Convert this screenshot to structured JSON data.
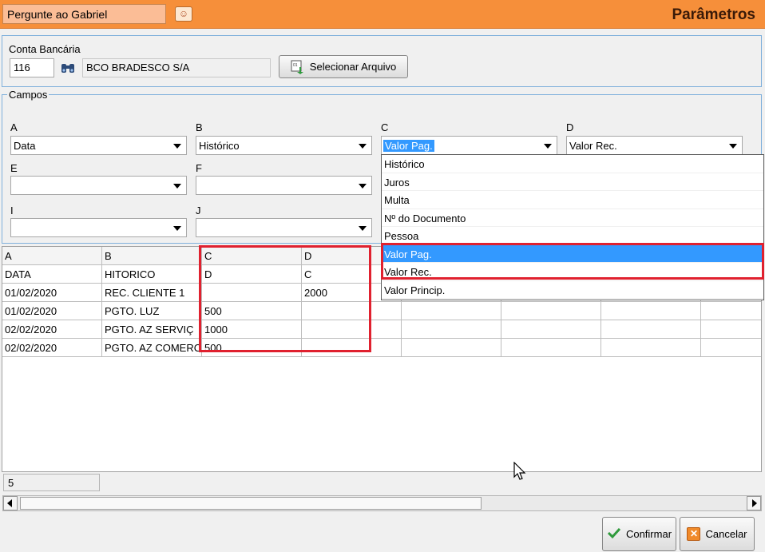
{
  "header": {
    "ask_value": "Pergunte ao Gabriel",
    "ask_icon": "help-person-icon",
    "title": "Parâmetros",
    "color": "#f68f3a"
  },
  "conta": {
    "label": "Conta Bancária",
    "code": "116",
    "search_icon": "binoculars-icon",
    "bank_name": "BCO BRADESCO S/A",
    "select_file_label": "Selecionar Arquivo"
  },
  "campos": {
    "label": "Campos",
    "fields": [
      {
        "letter": "A",
        "value": "Data"
      },
      {
        "letter": "B",
        "value": "Histórico"
      },
      {
        "letter": "C",
        "value": "Valor Pag."
      },
      {
        "letter": "D",
        "value": "Valor Rec."
      },
      {
        "letter": "E",
        "value": ""
      },
      {
        "letter": "F",
        "value": ""
      },
      {
        "letter": "I",
        "value": ""
      },
      {
        "letter": "J",
        "value": ""
      }
    ]
  },
  "dropdown": {
    "options": [
      "Histórico",
      "Juros",
      "Multa",
      "Nº do Documento",
      "Pessoa",
      "Valor Pag.",
      "Valor Rec.",
      "Valor Princip."
    ],
    "highlighted": "Valor Pag."
  },
  "grid": {
    "columns": [
      "A",
      "B",
      "C",
      "D",
      "",
      "",
      "",
      ""
    ],
    "rows": [
      [
        "DATA",
        "HITORICO",
        "D",
        "C",
        "",
        "",
        "",
        ""
      ],
      [
        "01/02/2020",
        "REC. CLIENTE 1",
        "",
        "2000",
        "",
        "",
        "",
        ""
      ],
      [
        "01/02/2020",
        "PGTO. LUZ",
        "500",
        "",
        "",
        "",
        "",
        ""
      ],
      [
        "02/02/2020",
        "PGTO.  AZ SERVIÇ",
        "1000",
        "",
        "",
        "",
        "",
        ""
      ],
      [
        "02/02/2020",
        "PGTO. AZ COMERC",
        "500",
        "",
        "",
        "",
        "",
        ""
      ]
    ]
  },
  "status": {
    "count": "5"
  },
  "footer": {
    "confirm_label": "Confirmar",
    "cancel_label": "Cancelar",
    "confirm_icon": "checkmark-icon",
    "cancel_icon": "close-icon"
  },
  "colors": {
    "highlight": "#3399ff",
    "annotation": "#e0212f"
  }
}
